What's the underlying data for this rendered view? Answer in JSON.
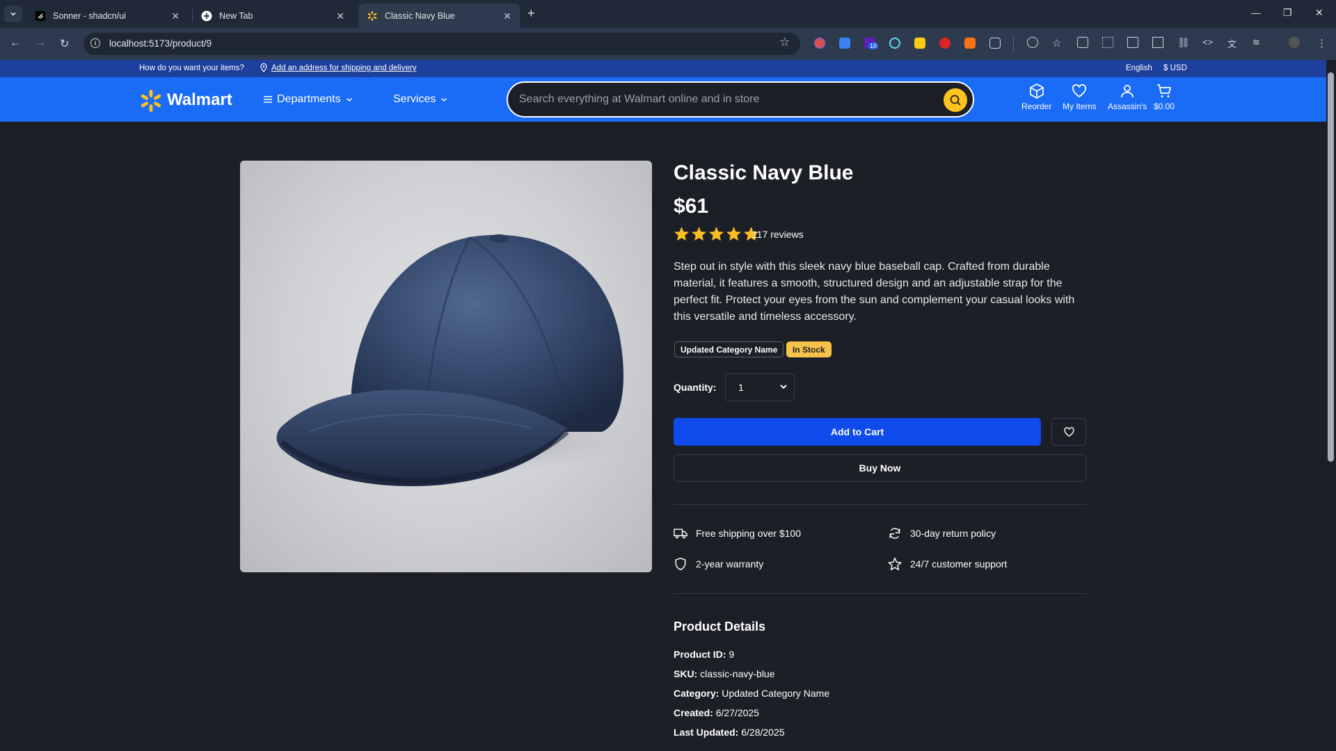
{
  "browser": {
    "tabs": [
      {
        "title": "Sonner - shadcn/ui"
      },
      {
        "title": "New Tab"
      },
      {
        "title": "Classic Navy Blue"
      }
    ],
    "url": "localhost:5173/product/9",
    "extension_badge": "10"
  },
  "topstrip": {
    "question": "How do you want your items?",
    "address_link": "Add an address for shipping and delivery",
    "language": "English",
    "currency": "$ USD"
  },
  "header": {
    "logo": "Walmart",
    "departments": "Departments",
    "services": "Services",
    "search_placeholder": "Search everything at Walmart online and in store",
    "reorder": "Reorder",
    "my_items": "My Items",
    "account": "Assassin's",
    "cart_total": "$0.00"
  },
  "product": {
    "title": "Classic Navy Blue",
    "price": "$61",
    "rating": 5,
    "reviews": "117 reviews",
    "description": "Step out in style with this sleek navy blue baseball cap. Crafted from durable material, it features a smooth, structured design and an adjustable strap for the perfect fit. Protect your eyes from the sun and complement your casual looks with this versatile and timeless accessory.",
    "category_badge": "Updated Category Name",
    "stock_badge": "In Stock",
    "quantity_label": "Quantity:",
    "quantity_value": "1",
    "add_to_cart": "Add to Cart",
    "buy_now": "Buy Now"
  },
  "features": {
    "shipping": "Free shipping over $100",
    "returns": "30-day return policy",
    "warranty": "2-year warranty",
    "support": "24/7 customer support"
  },
  "details": {
    "title": "Product Details",
    "id_label": "Product ID:",
    "id_value": "9",
    "sku_label": "SKU:",
    "sku_value": "classic-navy-blue",
    "category_label": "Category:",
    "category_value": "Updated Category Name",
    "created_label": "Created:",
    "created_value": "6/27/2025",
    "updated_label": "Last Updated:",
    "updated_value": "6/28/2025"
  },
  "colors": {
    "header_blue": "#1a6bf5",
    "strip_blue": "#1f3f9e",
    "cart_button": "#0f4bea",
    "spark_yellow": "#ffc220",
    "stock_yellow": "#f6c24a",
    "page_bg": "#1c1f26"
  }
}
